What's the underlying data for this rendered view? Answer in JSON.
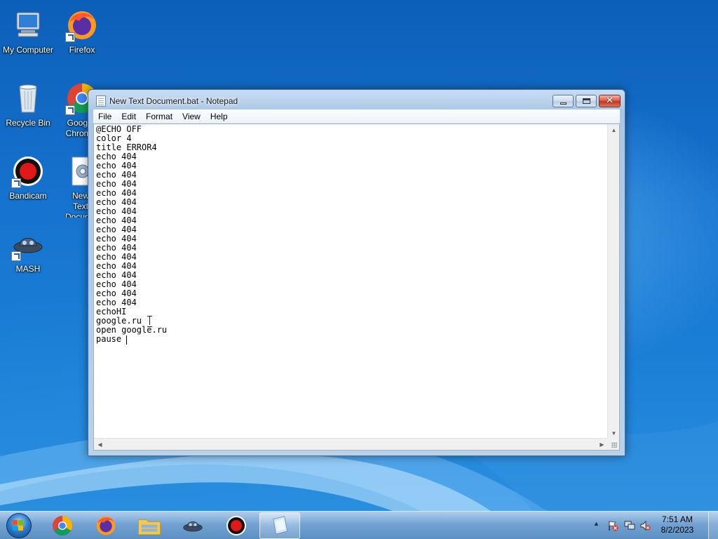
{
  "desktop": {
    "icons": [
      {
        "label": "My Computer",
        "icon": "computer-icon"
      },
      {
        "label": "Firefox",
        "icon": "firefox-icon"
      },
      {
        "label": "Recycle Bin",
        "icon": "recycle-bin-icon"
      },
      {
        "label": "Google Chrome",
        "icon": "chrome-icon"
      },
      {
        "label": "Bandicam",
        "icon": "bandicam-icon"
      },
      {
        "label": "New Text Document",
        "icon": "batch-file-icon"
      },
      {
        "label": "MASH",
        "icon": "mash-icon"
      }
    ]
  },
  "window": {
    "title": "New Text Document.bat - Notepad",
    "menu": [
      "File",
      "Edit",
      "Format",
      "View",
      "Help"
    ],
    "content_lines": [
      "@ECHO OFF",
      "color 4",
      "title ERROR4",
      "echo 404",
      "echo 404",
      "echo 404",
      "echo 404",
      "echo 404",
      "echo 404",
      "echo 404",
      "echo 404",
      "echo 404",
      "echo 404",
      "echo 404",
      "echo 404",
      "echo 404",
      "echo 404",
      "echo 404",
      "echo 404",
      "echo 404",
      "echoHI",
      "google.ru",
      "open google.ru",
      "pause"
    ]
  },
  "taskbar": {
    "pinned": [
      {
        "name": "chrome-icon"
      },
      {
        "name": "firefox-icon"
      },
      {
        "name": "file-explorer-icon"
      },
      {
        "name": "mash-icon"
      },
      {
        "name": "bandicam-icon"
      },
      {
        "name": "notepad-icon",
        "active": true
      }
    ],
    "clock_time": "7:51 AM",
    "clock_date": "8/2/2023"
  },
  "colors": {
    "wallpaper": "#1673cf",
    "close_button": "#c1361d",
    "window_frame": "#b7d0ea"
  }
}
